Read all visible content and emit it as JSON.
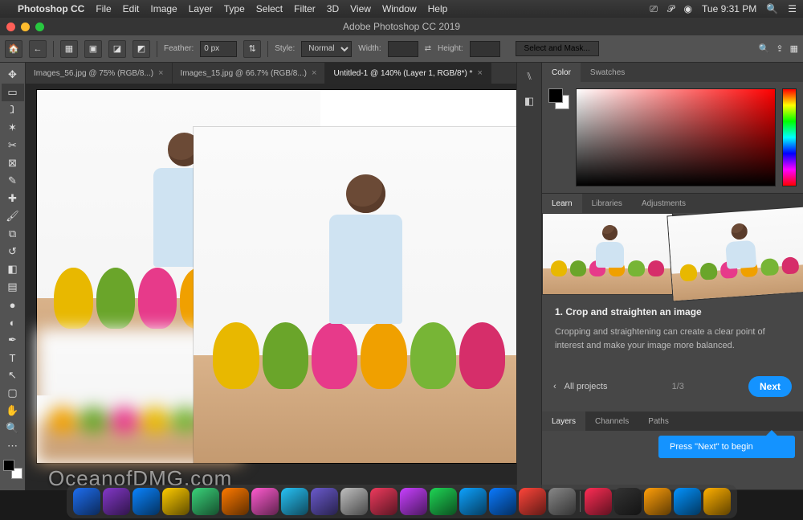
{
  "mac_menu": {
    "app_name": "Photoshop CC",
    "items": [
      "File",
      "Edit",
      "Image",
      "Layer",
      "Type",
      "Select",
      "Filter",
      "3D",
      "View",
      "Window",
      "Help"
    ],
    "clock": "Tue 9:31 PM"
  },
  "window_title": "Adobe Photoshop CC 2019",
  "options": {
    "feather_label": "Feather:",
    "feather_value": "0 px",
    "style_label": "Style:",
    "style_value": "Normal",
    "width_label": "Width:",
    "height_label": "Height:",
    "select_mask": "Select and Mask..."
  },
  "doc_tabs": [
    {
      "label": "Images_56.jpg @ 75% (RGB/8...)",
      "active": false
    },
    {
      "label": "Images_15.jpg @ 66.7% (RGB/8...)",
      "active": false
    },
    {
      "label": "Untitled-1 @ 140% (Layer 1, RGB/8*) *",
      "active": true
    }
  ],
  "panels": {
    "color_tabs": [
      "Color",
      "Swatches"
    ],
    "learn_tabs": [
      "Learn",
      "Libraries",
      "Adjustments"
    ],
    "layers_tabs": [
      "Layers",
      "Channels",
      "Paths"
    ]
  },
  "learn": {
    "title": "1.  Crop and straighten an image",
    "body": "Cropping and straightening can create a clear point of interest and make your image more balanced.",
    "back_label": "All projects",
    "progress": "1/3",
    "next_label": "Next",
    "coachmark": "Press \"Next\" to begin"
  },
  "watermark": "OceanofDMG.com",
  "dock_colors": [
    "#1e6ef0",
    "#8338c9",
    "#0a84ff",
    "#ffcc00",
    "#3ad47a",
    "#ff7a00",
    "#ff5bd0",
    "#27c3f7",
    "#6a5acd",
    "#c0c0c0",
    "#ef3a5d",
    "#c840ff",
    "#1fd655",
    "#0da2ff",
    "#0a7aff",
    "#ff453a",
    "#888888",
    "#ff2d55",
    "#333333",
    "#ff9f0a",
    "#0393ff",
    "#ffb000"
  ]
}
